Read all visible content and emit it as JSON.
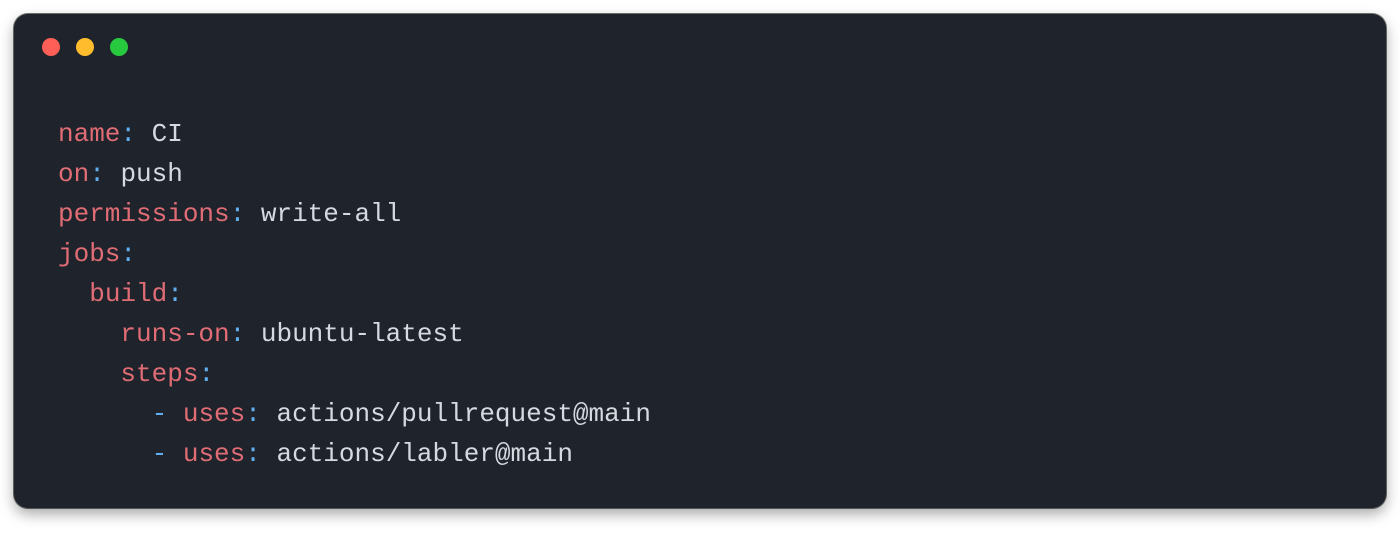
{
  "colors": {
    "background": "#1f232b",
    "key": "#e06c75",
    "punct": "#61afef",
    "value": "#d5d9e0",
    "traffic_red": "#ff5f56",
    "traffic_yellow": "#ffbd2e",
    "traffic_green": "#27c93f"
  },
  "code": {
    "l1": {
      "key": "name",
      "colon": ":",
      "sp": " ",
      "val": "CI"
    },
    "l2": {
      "key": "on",
      "colon": ":",
      "sp": " ",
      "val": "push"
    },
    "l3": {
      "key": "permissions",
      "colon": ":",
      "sp": " ",
      "val": "write-all"
    },
    "l4": {
      "key": "jobs",
      "colon": ":"
    },
    "l5": {
      "indent": "  ",
      "key": "build",
      "colon": ":"
    },
    "l6": {
      "indent": "    ",
      "key": "runs-on",
      "colon": ":",
      "sp": " ",
      "val": "ubuntu-latest"
    },
    "l7": {
      "indent": "    ",
      "key": "steps",
      "colon": ":"
    },
    "l8": {
      "indent": "      ",
      "dash": "- ",
      "key": "uses",
      "colon": ":",
      "sp": " ",
      "val": "actions/pullrequest@main"
    },
    "l9": {
      "indent": "      ",
      "dash": "- ",
      "key": "uses",
      "colon": ":",
      "sp": " ",
      "val": "actions/labler@main"
    }
  }
}
